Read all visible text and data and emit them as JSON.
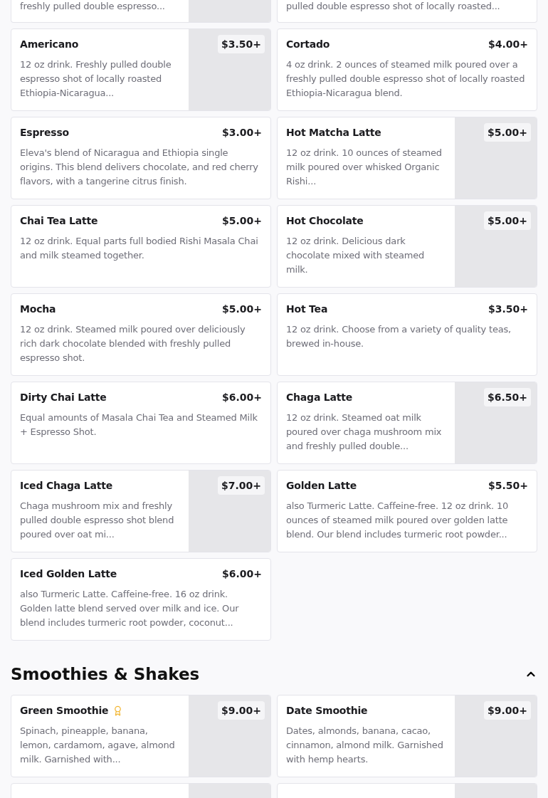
{
  "partial_items": [
    {
      "description": "freshly pulled double espresso...",
      "has_image": true
    },
    {
      "description": "pulled double espresso shot of locally roasted...",
      "has_image": false
    }
  ],
  "items": [
    {
      "name": "Americano",
      "price": "$3.50+",
      "description": "12 oz drink. Freshly pulled double espresso shot of locally roasted Ethiopia-Nicaragua...",
      "has_image": true,
      "badge": false
    },
    {
      "name": "Cortado",
      "price": "$4.00+",
      "description": "4 oz drink. 2 ounces of steamed milk poured over a freshly pulled double espresso shot of locally roasted Ethiopia-Nicaragua blend.",
      "has_image": false,
      "badge": false
    },
    {
      "name": "Espresso",
      "price": "$3.00+",
      "description": "Eleva's blend of Nicaragua and Ethiopia single origins. This blend delivers chocolate, and red cherry flavors, with a tangerine citrus finish.",
      "has_image": false,
      "badge": false
    },
    {
      "name": "Hot Matcha Latte",
      "price": "$5.00+",
      "description": "12 oz drink. 10 ounces of steamed milk poured over whisked Organic Rishi...",
      "has_image": true,
      "badge": false
    },
    {
      "name": "Chai Tea Latte",
      "price": "$5.00+",
      "description": "12 oz drink. Equal parts full bodied Rishi Masala Chai and milk steamed together.",
      "has_image": false,
      "badge": false
    },
    {
      "name": "Hot Chocolate",
      "price": "$5.00+",
      "description": "12 oz drink. Delicious dark chocolate mixed with steamed milk.",
      "has_image": true,
      "badge": false
    },
    {
      "name": "Mocha",
      "price": "$5.00+",
      "description": "12 oz drink. Steamed milk poured over deliciously rich dark chocolate blended with freshly pulled espresso shot.",
      "has_image": false,
      "badge": false
    },
    {
      "name": "Hot Tea",
      "price": "$3.50+",
      "description": "12 oz drink. Choose from a variety of quality teas, brewed in-house.",
      "has_image": false,
      "badge": false
    },
    {
      "name": "Dirty Chai Latte",
      "price": "$6.00+",
      "description": "Equal amounts of Masala Chai Tea and Steamed Milk + Espresso Shot.",
      "has_image": false,
      "badge": false
    },
    {
      "name": "Chaga Latte",
      "price": "$6.50+",
      "description": "12 oz drink. Steamed oat milk poured over chaga mushroom mix and freshly pulled double...",
      "has_image": true,
      "badge": false
    },
    {
      "name": "Iced Chaga Latte",
      "price": "$7.00+",
      "description": "Chaga mushroom mix and freshly pulled double espresso shot blend poured over oat mi...",
      "has_image": true,
      "badge": false
    },
    {
      "name": "Golden Latte",
      "price": "$5.50+",
      "description": "also Turmeric Latte. Caffeine-free. 12 oz drink. 10 ounces of steamed milk poured over golden latte blend. Our blend includes turmeric root powder...",
      "has_image": false,
      "badge": false
    },
    {
      "name": "Iced Golden Latte",
      "price": "$6.00+",
      "description": "also Turmeric Latte. Caffeine-free. 16 oz drink. Golden latte blend served over milk and ice. Our blend includes turmeric root powder, coconut...",
      "has_image": false,
      "badge": false
    }
  ],
  "section": {
    "title": "Smoothies & Shakes",
    "expanded": true,
    "items": [
      {
        "name": "Green Smoothie",
        "price": "$9.00+",
        "description": "Spinach, pineapple, banana, lemon, cardamom, agave, almond milk. Garnished with...",
        "has_image": true,
        "badge": true
      },
      {
        "name": "Date Smoothie",
        "price": "$9.00+",
        "description": "Dates, almonds, banana, cacao, cinnamon, almond milk. Garnished with hemp hearts.",
        "has_image": true,
        "badge": false
      }
    ],
    "cut_items": [
      {
        "has_image": true
      },
      {
        "has_image": true
      }
    ]
  }
}
